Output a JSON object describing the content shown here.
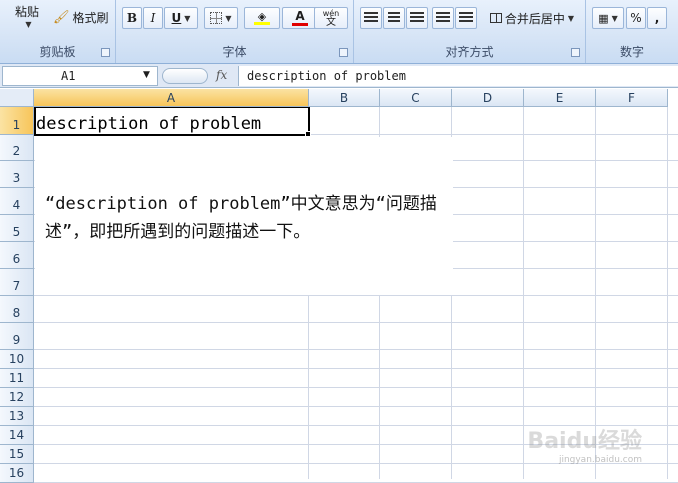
{
  "ribbon": {
    "clipboard": {
      "paste_label": "粘贴",
      "format_painter_label": "格式刷",
      "group_label": "剪贴板"
    },
    "font": {
      "bold": "B",
      "italic": "I",
      "underline": "U",
      "font_color_glyph": "A",
      "phonetic_top": "wén",
      "phonetic_bottom": "文",
      "group_label": "字体"
    },
    "alignment": {
      "merge_center_label": "合并后居中",
      "group_label": "对齐方式"
    },
    "number": {
      "percent": "%",
      "comma": ",",
      "group_label": "数字"
    }
  },
  "formula_bar": {
    "cell_ref": "A1",
    "fx_label": "fx",
    "content": "description of problem"
  },
  "columns": [
    "A",
    "B",
    "C",
    "D",
    "E",
    "F"
  ],
  "rows": [
    "1",
    "2",
    "3",
    "4",
    "5",
    "6",
    "7",
    "8",
    "9",
    "10",
    "11",
    "12",
    "13",
    "14",
    "15",
    "16"
  ],
  "cells": {
    "A1": "description of problem"
  },
  "note": "“description of problem”中文意思为“问题描述”，即把所遇到的问题描述一下。",
  "watermark": {
    "text": "Baidu经验",
    "url": "jingyan.baidu.com"
  },
  "colors": {
    "ribbon_bg": "#d6e4f6",
    "header_active": "#f7c55a",
    "grid_line": "#d0d7e5",
    "font_color_bar": "#e00000",
    "fill_color_bar": "#ffff00"
  }
}
